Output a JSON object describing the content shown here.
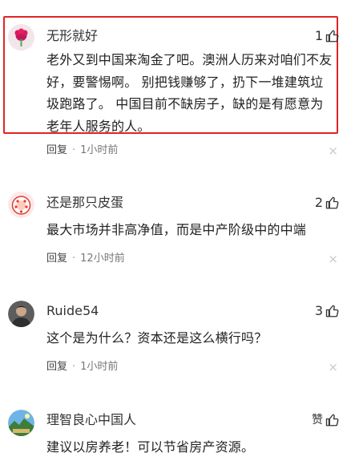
{
  "comments": [
    {
      "username": "无形就好",
      "likes": "1",
      "text": "老外又到中国来淘金了吧。澳洲人历来对咱们不友好，要警惕啊。 别把钱赚够了，扔下一堆建筑垃圾跑路了。 中国目前不缺房子，缺的是有愿意为老年人服务的人。",
      "reply_label": "回复",
      "separator": "·",
      "time": "1小时前",
      "close": "×"
    },
    {
      "username": "还是那只皮蛋",
      "likes": "2",
      "text": "最大市场并非高净值，而是中产阶级中的中端",
      "reply_label": "回复",
      "separator": "·",
      "time": "12小时前",
      "close": "×"
    },
    {
      "username": "Ruide54",
      "likes": "3",
      "text": "这个是为什么？资本还是这么横行吗？",
      "reply_label": "回复",
      "separator": "·",
      "time": "1小时前",
      "close": "×"
    },
    {
      "username": "理智良心中国人",
      "likes": "赞",
      "text": "建议以房养老！可以节省房产资源。"
    }
  ],
  "colors": {
    "highlight_border": "#e02424",
    "meta_text": "#777777"
  }
}
